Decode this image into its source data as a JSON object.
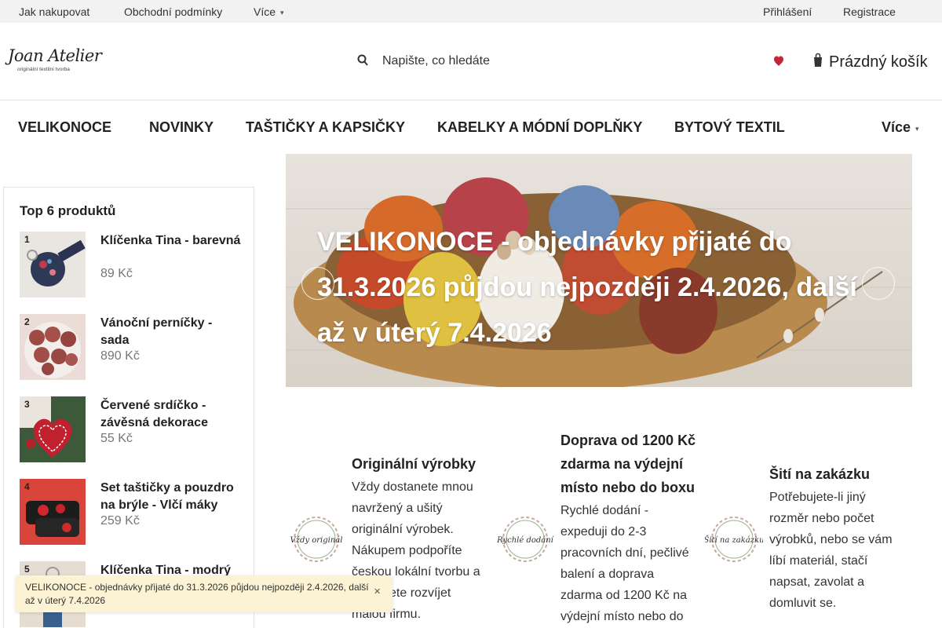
{
  "topbar": {
    "links": [
      "Jak nakupovat",
      "Obchodní podmínky",
      "Více"
    ],
    "login": "Přihlášení",
    "register": "Registrace"
  },
  "header": {
    "logo_script": "Joan Atelier",
    "logo_tagline": "originální textilní tvorba",
    "search_placeholder": "Napište, co hledáte",
    "cart_label": "Prázdný košík"
  },
  "nav": {
    "items": [
      "VELIKONOCE",
      "NOVINKY",
      "TAŠTIČKY A KAPSIČKY",
      "KABELKY A MÓDNÍ DOPLŇKY",
      "BYTOVÝ TEXTIL"
    ],
    "more": "Více"
  },
  "sidebar": {
    "title": "Top 6 produktů",
    "products": [
      {
        "rank": "1",
        "name": "Klíčenka Tina - barevná",
        "price": "89 Kč"
      },
      {
        "rank": "2",
        "name": "Vánoční perníčky - sada",
        "price": "890 Kč"
      },
      {
        "rank": "3",
        "name": "Červené srdíčko - závěsná dekorace",
        "price": "55 Kč"
      },
      {
        "rank": "4",
        "name": "Set taštičky a pouzdro na brýle - Vlčí máky",
        "price": "259 Kč"
      },
      {
        "rank": "5",
        "name": "Klíčenka Tina - modrý",
        "price": ""
      }
    ]
  },
  "banner": {
    "text": "VELIKONOCE - objednávky přijaté do 31.3.2026 půjdou nejpozději 2.4.2026, další až v úterý 7.4.2026"
  },
  "features": [
    {
      "icon_label": "Vždy originál",
      "title": "Originální výrobky",
      "text": "Vždy dostanete mnou navržený a ušitý originální výrobek. Nákupem podpoříte českou lokální tvorbu a pomůžete rozvíjet malou firmu."
    },
    {
      "icon_label": "Rychlé dodání",
      "title": "Doprava od 1200 Kč zdarma na výdejní místo nebo do boxu",
      "text": "Rychlé dodání - expeduji do 2-3 pracovních dní, pečlivé balení a doprava zdarma od 1200 Kč na výdejní místo nebo do"
    },
    {
      "icon_label": "Šití na zakázku",
      "title": "Šití na zakázku",
      "text": "Potřebujete-li jiný rozměr nebo počet výrobků, nebo se vám líbí materiál, stačí napsat, zavolat a domluvit se."
    }
  ],
  "notice": {
    "text": "VELIKONOCE - objednávky přijaté do 31.3.2026 půjdou nejpozději 2.4.2026, další až v úterý 7.4.2026"
  },
  "colors": {
    "topbar_bg": "#f2f2f2",
    "heart": "#c0283a",
    "notice_bg": "#fbf3d4",
    "price": "#777777"
  }
}
